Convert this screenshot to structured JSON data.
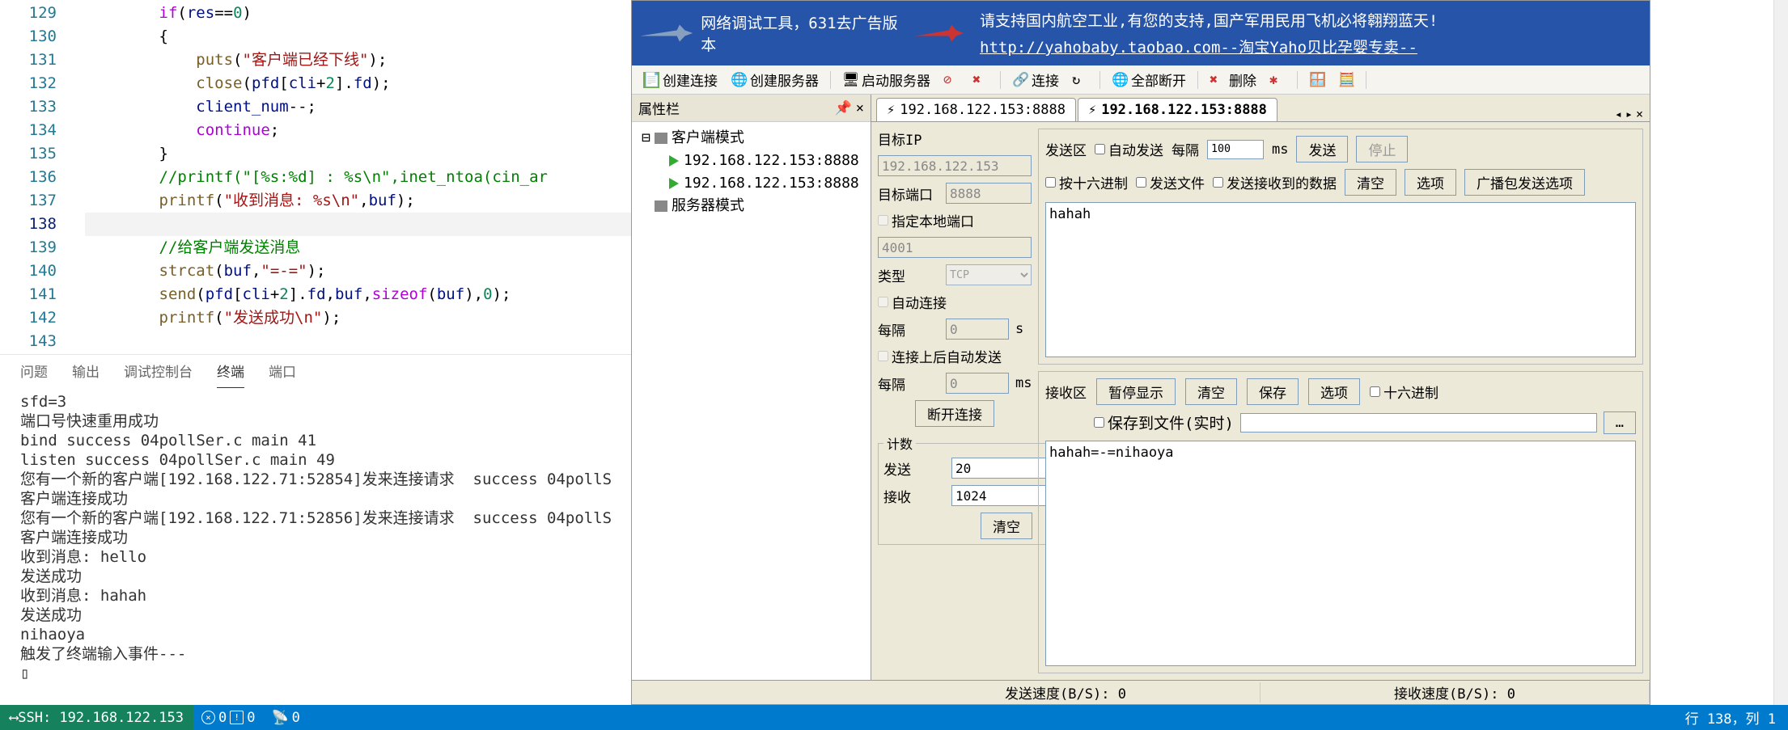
{
  "editor": {
    "lines": [
      {
        "n": 129,
        "html": "        <span class='kw'>if</span>(<span class='var'>res</span>==<span class='num'>0</span>)"
      },
      {
        "n": 130,
        "html": "        {"
      },
      {
        "n": 131,
        "html": "            <span class='fn'>puts</span>(<span class='str'>\"客户端已经下线\"</span>);"
      },
      {
        "n": 132,
        "html": "            <span class='fn'>close</span>(<span class='var'>pfd</span>[<span class='var'>cli</span>+<span class='num'>2</span>].<span class='var'>fd</span>);"
      },
      {
        "n": 133,
        "html": "            <span class='var'>client_num</span>--;"
      },
      {
        "n": 134,
        "html": "            <span class='kw'>continue</span>;"
      },
      {
        "n": 135,
        "html": "        }"
      },
      {
        "n": 136,
        "html": "        <span class='cmt'>//printf(\"[%s:%d] : %s\\n\",inet_ntoa(cin_ar</span>"
      },
      {
        "n": 137,
        "html": "        <span class='fn'>printf</span>(<span class='str'>\"收到消息: %s\\n\"</span>,<span class='var'>buf</span>);"
      },
      {
        "n": 138,
        "html": "",
        "current": true
      },
      {
        "n": 139,
        "html": "        <span class='cmt'>//给客户端发送消息</span>"
      },
      {
        "n": 140,
        "html": "        <span class='fn'>strcat</span>(<span class='var'>buf</span>,<span class='str'>\"=-=\"</span>);"
      },
      {
        "n": 141,
        "html": "        <span class='fn'>send</span>(<span class='var'>pfd</span>[<span class='var'>cli</span>+<span class='num'>2</span>].<span class='var'>fd</span>,<span class='var'>buf</span>,<span class='kw'>sizeof</span>(<span class='var'>buf</span>),<span class='num'>0</span>);"
      },
      {
        "n": 142,
        "html": "        <span class='fn'>printf</span>(<span class='str'>\"发送成功\\n\"</span>);"
      },
      {
        "n": 143,
        "html": ""
      }
    ]
  },
  "panel_tabs": {
    "problems": "问题",
    "output": "输出",
    "debug": "调试控制台",
    "terminal": "终端",
    "ports": "端口"
  },
  "terminal_text": "sfd=3\n端口号快速重用成功\nbind success 04pollSer.c main 41\nlisten success 04pollSer.c main 49\n您有一个新的客户端[192.168.122.71:52854]发来连接请求  success 04pollS\n客户端连接成功\n您有一个新的客户端[192.168.122.71:52856]发来连接请求  success 04pollS\n客户端连接成功\n收到消息: hello\n发送成功\n收到消息: hahah\n发送成功\nnihaoya\n触发了终端输入事件---\n▯",
  "statusbar": {
    "ssh": "SSH: 192.168.122.153",
    "err": "0",
    "warn": "0",
    "port": "0",
    "pos": "行 138，列 1"
  },
  "banner": {
    "t1": "网络调试工具，631去广告版本",
    "t2": "请支持国内航空工业,有您的支持,国产军用民用飞机必将翱翔蓝天!",
    "t3": "http://yahobaby.taobao.com--淘宝Yaho贝比孕婴专卖--"
  },
  "toolbar": {
    "create_conn": "创建连接",
    "create_srv": "创建服务器",
    "start_srv": "启动服务器",
    "connect": "连接",
    "disconnect_all": "全部断开",
    "delete": "删除"
  },
  "tree": {
    "header": "属性栏",
    "root": "客户端模式",
    "c1": "192.168.122.153:8888",
    "c2": "192.168.122.153:8888",
    "srv": "服务器模式"
  },
  "tabs": {
    "t1": "192.168.122.153:8888",
    "t2": "192.168.122.153:8888"
  },
  "cfg": {
    "dest_ip_lbl": "目标IP",
    "dest_ip": "192.168.122.153",
    "dest_port_lbl": "目标端口",
    "dest_port": "8888",
    "local_port_lbl": "指定本地端口",
    "local_port": "4001",
    "type_lbl": "类型",
    "type": "TCP",
    "auto_conn": "自动连接",
    "every": "每隔",
    "s": "s",
    "ms": "ms",
    "auto_send_after": "连接上后自动发送",
    "int1": "0",
    "int2": "0",
    "disconnect": "断开连接",
    "count_hdr": "计数",
    "sent_lbl": "发送",
    "sent": "20",
    "recv_lbl": "接收",
    "recv": "1024",
    "clear": "清空"
  },
  "sendbox": {
    "title": "发送区",
    "auto": "自动发送",
    "every": "每隔",
    "interval": "100",
    "ms": "ms",
    "send": "发送",
    "stop": "停止",
    "hex": "按十六进制",
    "file": "发送文件",
    "echo": "发送接收到的数据",
    "clear": "清空",
    "opts": "选项",
    "broadcast": "广播包发送选项",
    "text": "hahah"
  },
  "recvbox": {
    "title": "接收区",
    "pause": "暂停显示",
    "clear": "清空",
    "save": "保存",
    "opts": "选项",
    "hex": "十六进制",
    "save_file": "保存到文件(实时)",
    "text": "hahah=-=nihaoya"
  },
  "speed": {
    "send": "发送速度(B/S): 0",
    "recv": "接收速度(B/S): 0"
  }
}
